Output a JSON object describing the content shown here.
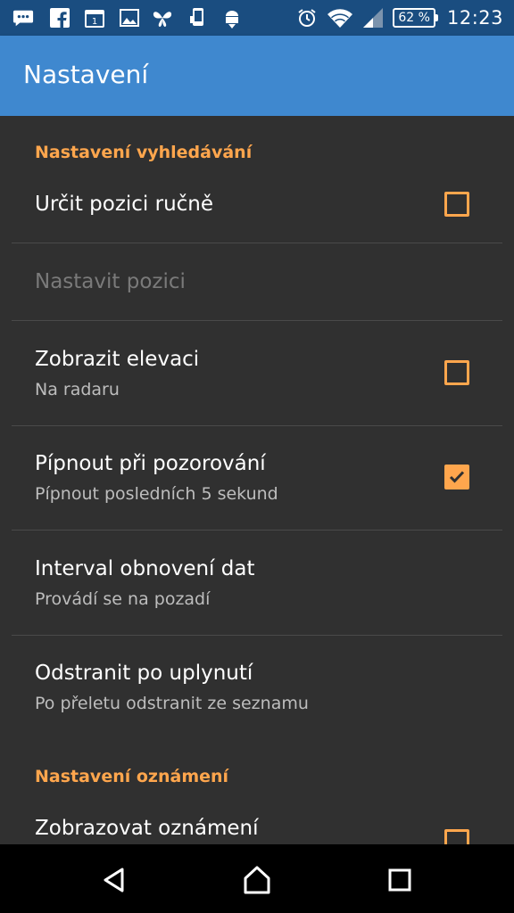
{
  "status_bar": {
    "battery_label": "62 %",
    "time": "12:23",
    "icons": [
      "chat-icon",
      "facebook-icon",
      "calendar-icon",
      "image-icon",
      "bird-icon",
      "phone-icon",
      "android-download-icon",
      "alarm-icon",
      "wifi-icon",
      "signal-icon"
    ]
  },
  "app_bar": {
    "title": "Nastavení"
  },
  "sections": [
    {
      "header": "Nastavení vyhledávání",
      "items": [
        {
          "title": "Určit pozici ručně",
          "summary": "",
          "checkbox": true,
          "checked": false,
          "enabled": true
        },
        {
          "title": "Nastavit pozici",
          "summary": "",
          "checkbox": false,
          "enabled": false
        },
        {
          "title": "Zobrazit elevaci",
          "summary": "Na radaru",
          "checkbox": true,
          "checked": false,
          "enabled": true
        },
        {
          "title": "Pípnout při pozorování",
          "summary": "Pípnout posledních 5 sekund",
          "checkbox": true,
          "checked": true,
          "enabled": true
        },
        {
          "title": "Interval obnovení dat",
          "summary": "Provádí se na pozadí",
          "checkbox": false,
          "enabled": true
        },
        {
          "title": "Odstranit po uplynutí",
          "summary": "Po přeletu odstranit ze seznamu",
          "checkbox": false,
          "enabled": true
        }
      ]
    },
    {
      "header": "Nastavení oznámení",
      "items": [
        {
          "title": "Zobrazovat oznámení",
          "summary": "",
          "checkbox": true,
          "checked": false,
          "enabled": true
        }
      ]
    }
  ],
  "colors": {
    "status_bar": "#1a4d80",
    "app_bar": "#3f88cf",
    "background": "#303030",
    "accent": "#ffa64d"
  },
  "nav_bar": {
    "icons": [
      "back-icon",
      "home-icon",
      "recents-icon"
    ]
  }
}
